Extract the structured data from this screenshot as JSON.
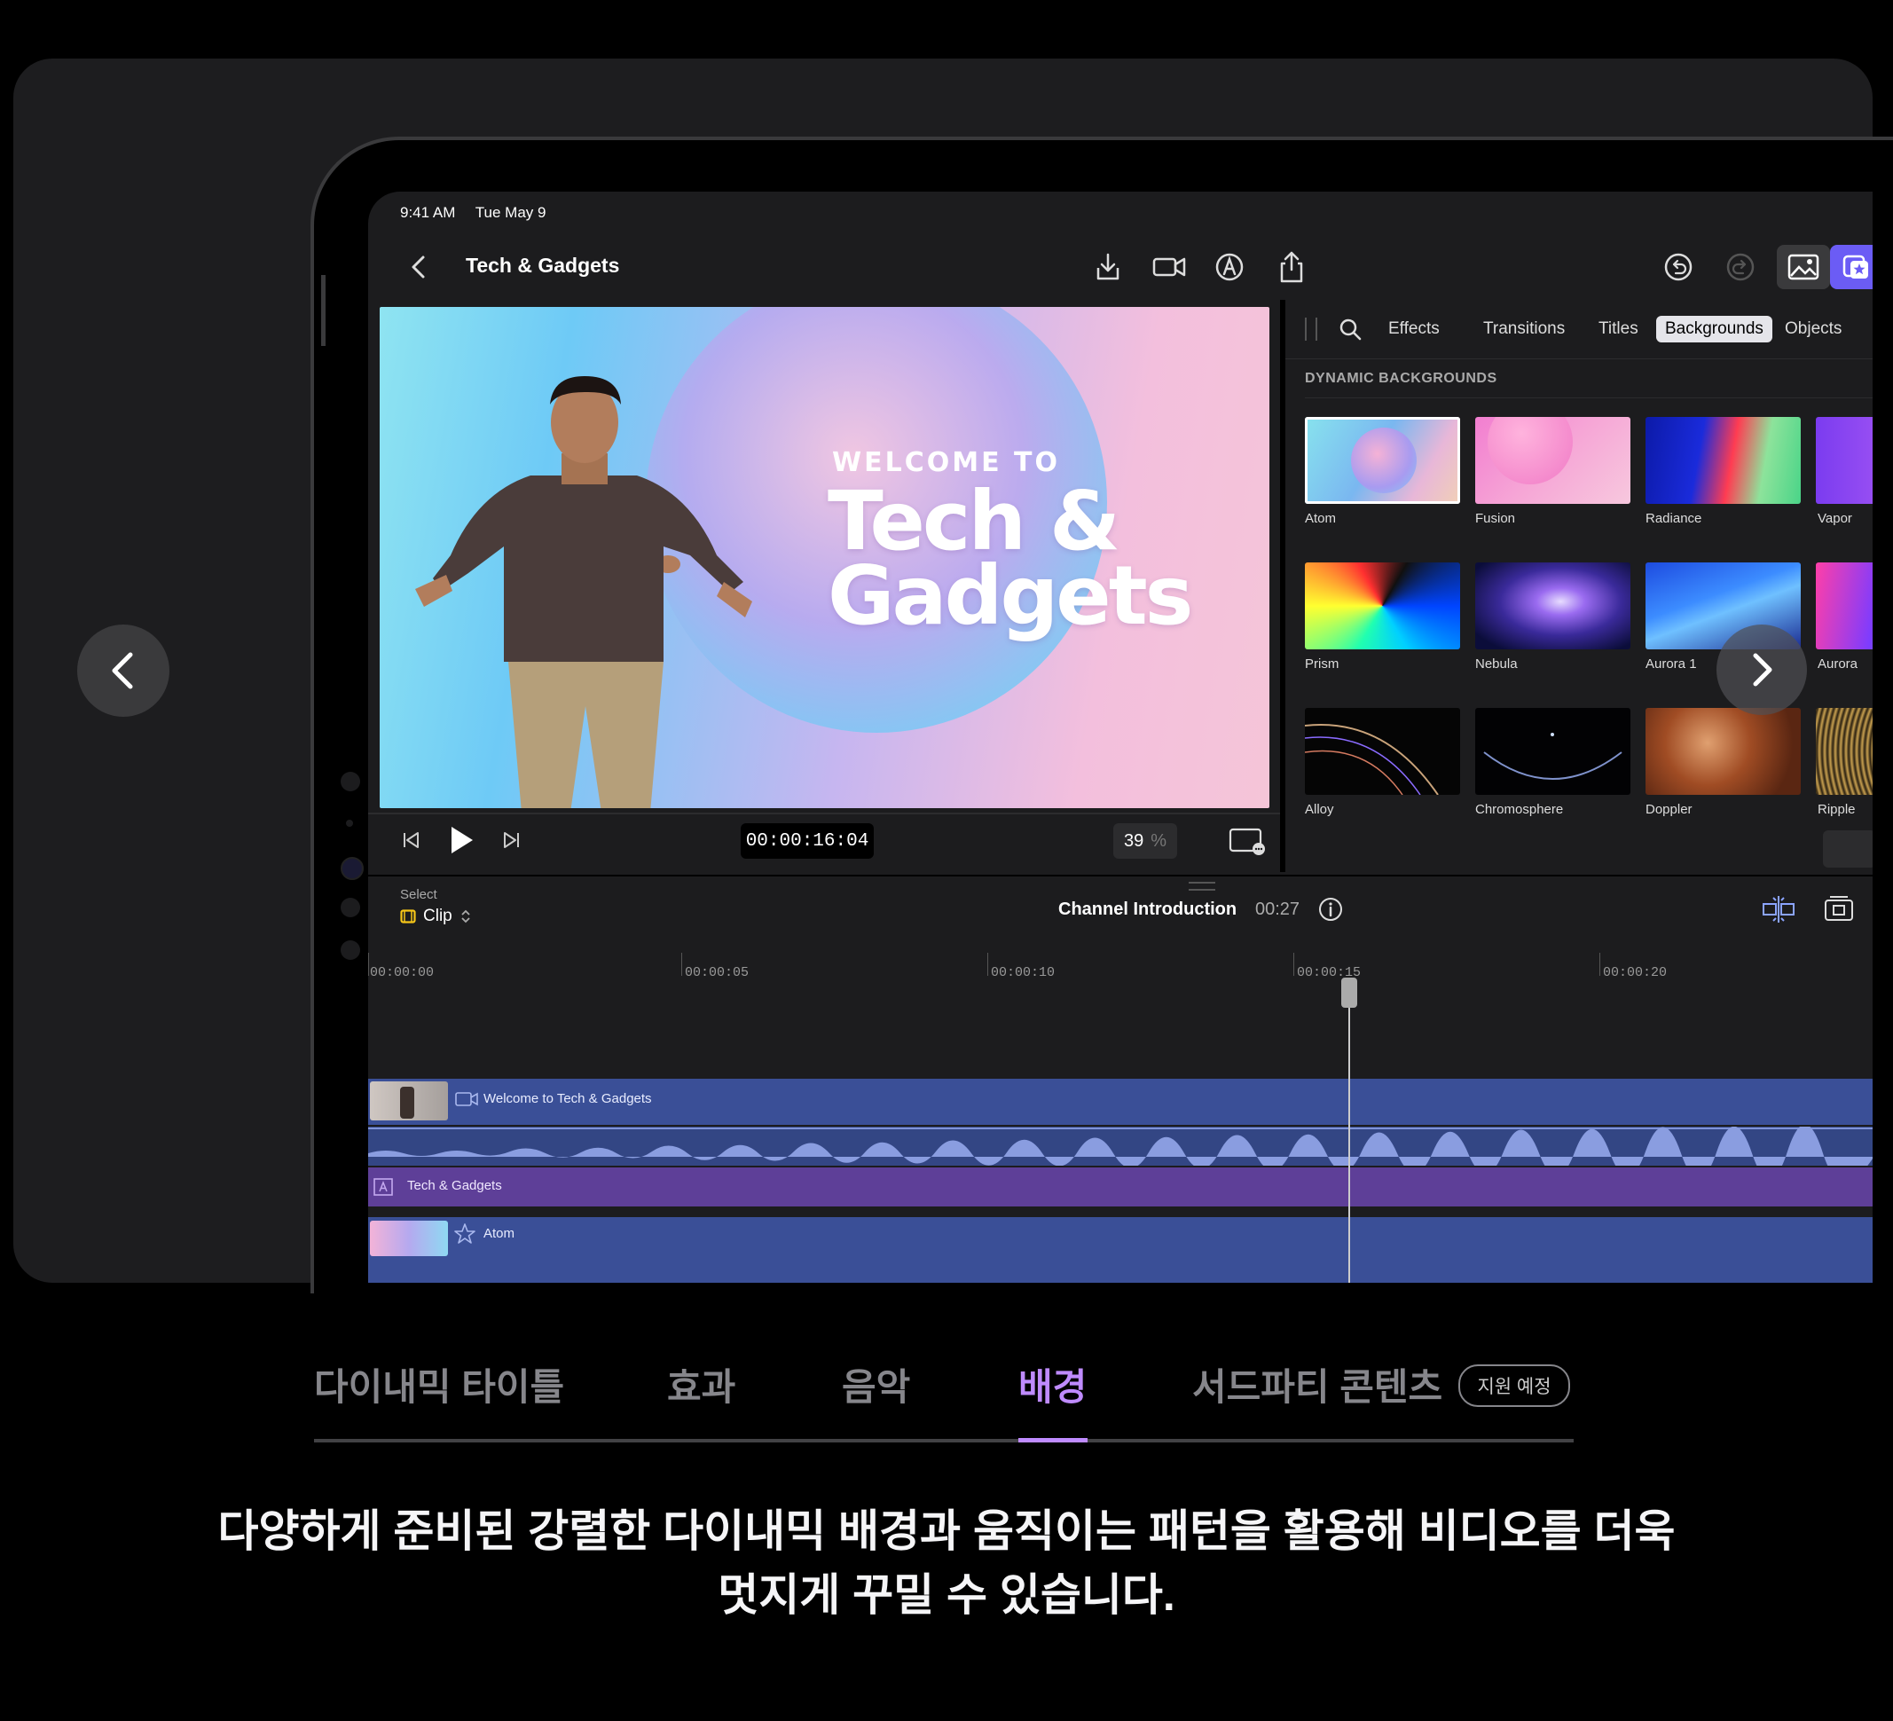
{
  "device": {
    "status_time": "9:41 AM",
    "status_date": "Tue May 9"
  },
  "topbar": {
    "project_title": "Tech & Gadgets",
    "icons": [
      "back-chevron-icon",
      "import-icon",
      "camera-icon",
      "voiceover-icon",
      "share-icon",
      "undo-icon",
      "redo-icon",
      "photo-icon",
      "browser-icon"
    ]
  },
  "viewer": {
    "welcome_text": "WELCOME TO",
    "title_line1": "Tech &",
    "title_line2": "Gadgets"
  },
  "transport": {
    "timecode": "00:00:16:04",
    "zoom_value": "39",
    "zoom_unit": "%"
  },
  "browser": {
    "tabs": [
      "Effects",
      "Transitions",
      "Titles",
      "Backgrounds",
      "Objects"
    ],
    "active_tab": "Backgrounds",
    "section_title": "DYNAMIC BACKGROUNDS",
    "items": [
      "Atom",
      "Fusion",
      "Radiance",
      "Vapor",
      "Prism",
      "Nebula",
      "Aurora 1",
      "Aurora",
      "Alloy",
      "Chromosphere",
      "Doppler",
      "Ripple"
    ],
    "selected_item": "Atom"
  },
  "timeline": {
    "select_label": "Select",
    "select_mode": "Clip",
    "project_name": "Channel Introduction",
    "project_duration": "00:27",
    "ruler": [
      "00:00:00",
      "00:00:05",
      "00:00:10",
      "00:00:15",
      "00:00:20"
    ],
    "tracks": {
      "video_clip": "Welcome to Tech & Gadgets",
      "title_clip": "Tech & Gadgets",
      "background_clip": "Atom"
    }
  },
  "categories": {
    "items": [
      "다이내믹 타이틀",
      "효과",
      "음악",
      "배경",
      "서드파티 콘텐츠"
    ],
    "active": "배경",
    "badge": "지원 예정"
  },
  "description": {
    "line1": "다양하게 준비된 강렬한 다이내믹 배경과 움직이는 패턴을 활용해 비디오를 더욱",
    "line2": "멋지게 꾸밀 수 있습니다."
  },
  "colors": {
    "accent": "#bf8bff",
    "video_track": "#374a8c",
    "title_track": "#5b3d8f"
  }
}
